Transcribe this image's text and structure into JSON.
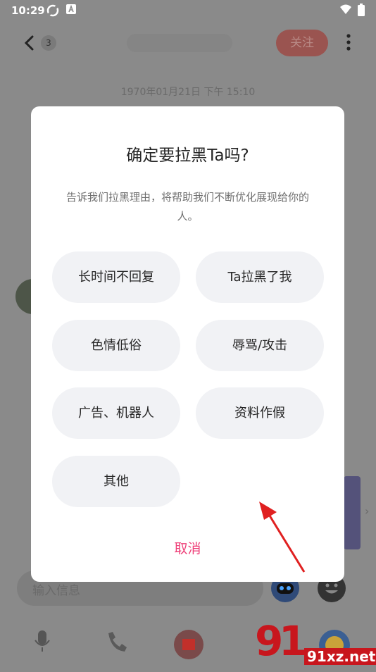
{
  "status_bar": {
    "time": "10:29",
    "icons": [
      "sync-icon",
      "a-icon",
      "wifi-icon",
      "battery-icon"
    ]
  },
  "topbar": {
    "unread_count": "3",
    "follow_label": "关注"
  },
  "chat": {
    "timestamp": "1970年01月21日 下午 15:10",
    "input_placeholder": "输入信息"
  },
  "dialog": {
    "title": "确定要拉黑Ta吗?",
    "description": "告诉我们拉黑理由，将帮助我们不断优化展现给你的人。",
    "reasons": [
      "长时间不回复",
      "Ta拉黑了我",
      "色情低俗",
      "辱骂/攻击",
      "广告、机器人",
      "资料作假",
      "其他"
    ],
    "cancel_label": "取消"
  },
  "watermark": {
    "text": "91xz.net"
  },
  "colors": {
    "accent": "#ee3f78",
    "dialog_bg": "#ffffff",
    "chip_bg": "#f1f2f5",
    "overlay": "#8a8a8a",
    "annotation_arrow": "#e02020"
  }
}
